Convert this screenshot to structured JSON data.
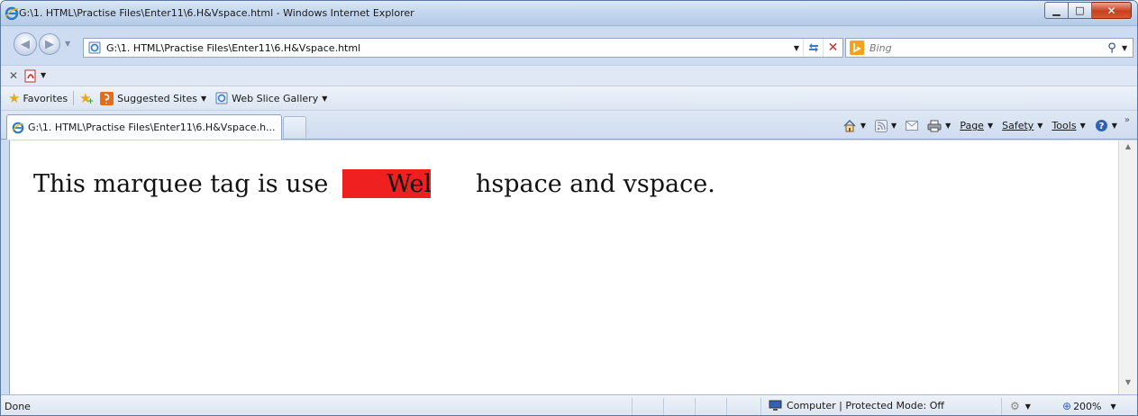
{
  "window": {
    "title": "G:\\1. HTML\\Practise Files\\Enter11\\6.H&Vspace.html - Windows Internet Explorer"
  },
  "address_bar": {
    "url": "G:\\1. HTML\\Practise Files\\Enter11\\6.H&Vspace.html"
  },
  "search": {
    "placeholder": "Bing"
  },
  "favorites_bar": {
    "favorites_label": "Favorites",
    "suggested_sites_label": "Suggested Sites",
    "web_slice_gallery_label": "Web Slice Gallery"
  },
  "tabs": [
    {
      "label": "G:\\1. HTML\\Practise Files\\Enter11\\6.H&Vspace.h..."
    }
  ],
  "command_bar": {
    "page_label": "Page",
    "safety_label": "Safety",
    "tools_label": "Tools"
  },
  "content": {
    "left_text": "This marquee tag is use",
    "marquee_text": "Wel",
    "right_text": "hspace and vspace.",
    "marquee_background": "#ef2020"
  },
  "status_bar": {
    "status_text": "Done",
    "zone_text": "Computer | Protected Mode: Off",
    "zoom_text": "200%"
  }
}
